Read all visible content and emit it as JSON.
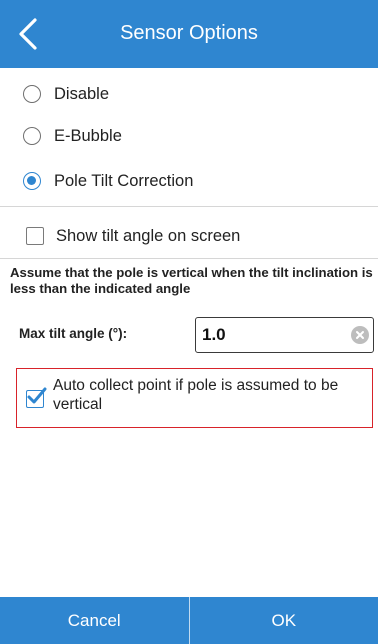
{
  "header": {
    "title": "Sensor Options",
    "back_icon": "chevron-left-icon",
    "color": "#2f86d0"
  },
  "mode_options": [
    {
      "label": "Disable",
      "selected": false
    },
    {
      "label": "E-Bubble",
      "selected": false
    },
    {
      "label": "Pole Tilt Correction",
      "selected": true
    }
  ],
  "show_tilt": {
    "label": "Show tilt angle on screen",
    "checked": false
  },
  "note": "Assume that the pole is vertical when the tilt inclination is less than the indicated angle",
  "max_tilt": {
    "label": "Max tilt angle (°):",
    "value": "1.0",
    "clear_icon": "clear-icon"
  },
  "auto_collect": {
    "label": "Auto collect point if pole is assumed to be vertical",
    "checked": true
  },
  "footer": {
    "cancel_label": "Cancel",
    "ok_label": "OK"
  },
  "colors": {
    "accent": "#2f86d0",
    "highlight": "#d8232a"
  }
}
